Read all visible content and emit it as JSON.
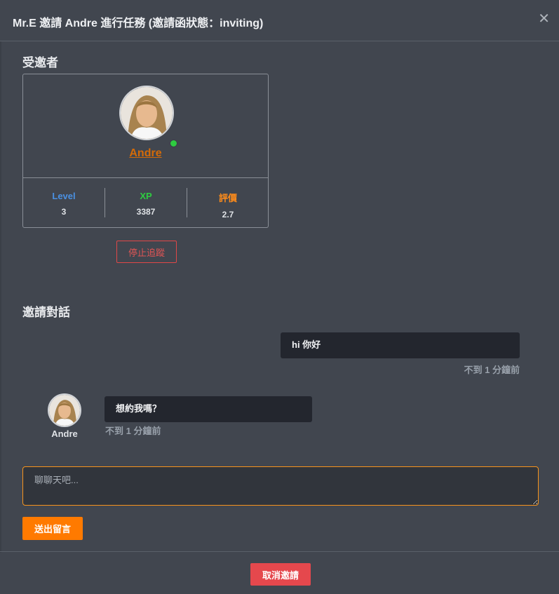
{
  "modal": {
    "title": "Mr.E 邀請 Andre 進行任務 (邀請函狀態：inviting)",
    "close_icon": "close-icon"
  },
  "invitee": {
    "section_title": "受邀者",
    "name": "Andre",
    "online": true,
    "stats": [
      {
        "label": "Level",
        "value": "3",
        "color": "#4a90e2"
      },
      {
        "label": "XP",
        "value": "3387",
        "color": "#2ecc40"
      },
      {
        "label": "評價",
        "value": "2.7",
        "color": "#ff8c1a"
      }
    ],
    "unfollow_label": "停止追蹤"
  },
  "chat": {
    "section_title": "邀請對話",
    "messages": [
      {
        "sender": "me",
        "text": "hi 你好",
        "time": "不到 1 分鐘前"
      },
      {
        "sender": "Andre",
        "text": "想約我嗎？",
        "time": "不到 1 分鐘前"
      }
    ],
    "input_placeholder": "聊聊天吧...",
    "send_label": "送出留言"
  },
  "footer": {
    "cancel_label": "取消邀請"
  },
  "colors": {
    "background": "#41464f",
    "accent_orange": "#ff7a00",
    "danger": "#e5484d",
    "bubble": "#23262e"
  }
}
